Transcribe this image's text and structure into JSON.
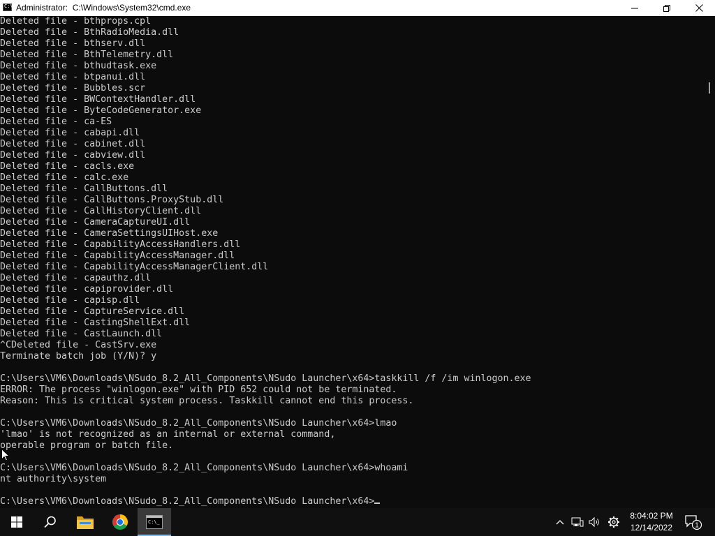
{
  "window": {
    "title": "Administrator:  C:\\Windows\\System32\\cmd.exe",
    "icon_text": "C:\\"
  },
  "console": {
    "lines": [
      "Deleted file - bthprops.cpl",
      "Deleted file - BthRadioMedia.dll",
      "Deleted file - bthserv.dll",
      "Deleted file - BthTelemetry.dll",
      "Deleted file - bthudtask.exe",
      "Deleted file - btpanui.dll",
      "Deleted file - Bubbles.scr",
      "Deleted file - BWContextHandler.dll",
      "Deleted file - ByteCodeGenerator.exe",
      "Deleted file - ca-ES",
      "Deleted file - cabapi.dll",
      "Deleted file - cabinet.dll",
      "Deleted file - cabview.dll",
      "Deleted file - cacls.exe",
      "Deleted file - calc.exe",
      "Deleted file - CallButtons.dll",
      "Deleted file - CallButtons.ProxyStub.dll",
      "Deleted file - CallHistoryClient.dll",
      "Deleted file - CameraCaptureUI.dll",
      "Deleted file - CameraSettingsUIHost.exe",
      "Deleted file - CapabilityAccessHandlers.dll",
      "Deleted file - CapabilityAccessManager.dll",
      "Deleted file - CapabilityAccessManagerClient.dll",
      "Deleted file - capauthz.dll",
      "Deleted file - capiprovider.dll",
      "Deleted file - capisp.dll",
      "Deleted file - CaptureService.dll",
      "Deleted file - CastingShellExt.dll",
      "Deleted file - CastLaunch.dll",
      "^CDeleted file - CastSrv.exe",
      "Terminate batch job (Y/N)? y",
      "",
      "C:\\Users\\VM6\\Downloads\\NSudo_8.2_All_Components\\NSudo Launcher\\x64>taskkill /f /im winlogon.exe",
      "ERROR: The process \"winlogon.exe\" with PID 652 could not be terminated.",
      "Reason: This is critical system process. Taskkill cannot end this process.",
      "",
      "C:\\Users\\VM6\\Downloads\\NSudo_8.2_All_Components\\NSudo Launcher\\x64>lmao",
      "'lmao' is not recognized as an internal or external command,",
      "operable program or batch file.",
      "",
      "C:\\Users\\VM6\\Downloads\\NSudo_8.2_All_Components\\NSudo Launcher\\x64>whoami",
      "nt authority\\system",
      ""
    ],
    "prompt": "C:\\Users\\VM6\\Downloads\\NSudo_8.2_All_Components\\NSudo Launcher\\x64>"
  },
  "taskbar": {
    "time": "8:04:02 PM",
    "date": "12/14/2022",
    "notification_count": "1",
    "icons": [
      "windows-start-icon",
      "search-icon",
      "file-explorer-icon",
      "chrome-icon",
      "cmd-icon"
    ],
    "tray_icons": [
      "chevron-up-icon",
      "network-icon",
      "volume-icon",
      "settings-icon",
      "notification-icon"
    ]
  },
  "colors": {
    "console_bg": "#0c0c0c",
    "console_fg": "#cccccc",
    "taskbar_bg": "#101010",
    "active_accent": "#86b7e0"
  }
}
